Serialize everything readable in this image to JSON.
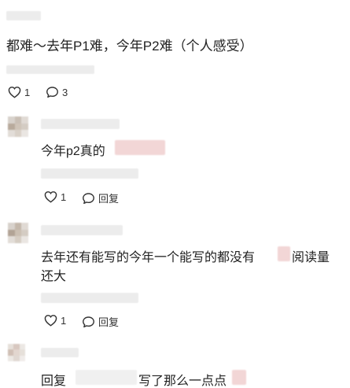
{
  "top_comment": {
    "text": "都难～去年P1难，今年P2难（个人感受）",
    "like_count": "1",
    "reply_count": "3"
  },
  "replies": [
    {
      "text": "今年p2真的",
      "like_count": "1",
      "reply_label": "回复"
    },
    {
      "text_line1": "去年还有能写的今年一个能写的都没有",
      "text_line1_tail": "阅读量",
      "text_line2": "还大",
      "like_count": "1",
      "reply_label": "回复"
    },
    {
      "text_prefix": "回复",
      "text_middle": "写了那么一点点"
    }
  ],
  "icons": {
    "like": "heart-icon",
    "comment": "comment-bubble-icon"
  },
  "colors": {
    "text": "#222222",
    "muted": "#333333",
    "redaction": "#ececec",
    "pink_redaction": "#f2d6d6"
  }
}
